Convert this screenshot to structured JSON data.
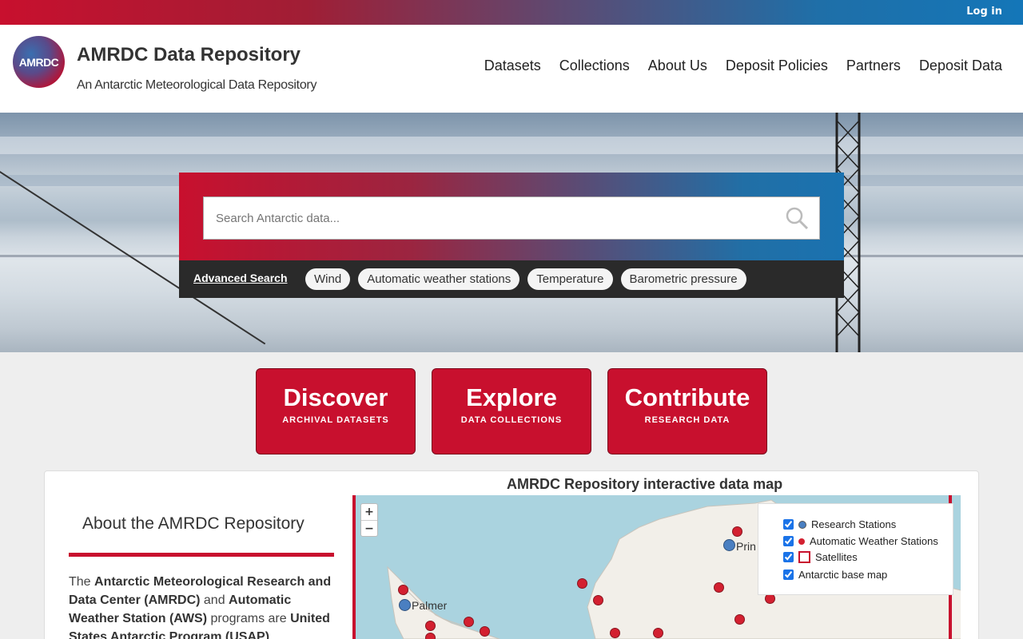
{
  "topbar": {
    "login": "Log in"
  },
  "header": {
    "logo_text": "AMRDC",
    "title": "AMRDC Data Repository",
    "subtitle": "An Antarctic Meteorological Data Repository",
    "nav": [
      "Datasets",
      "Collections",
      "About Us",
      "Deposit Policies",
      "Partners",
      "Deposit Data"
    ]
  },
  "search": {
    "placeholder": "Search Antarctic data...",
    "advanced": "Advanced Search",
    "tags": [
      "Wind",
      "Automatic weather stations",
      "Temperature",
      "Barometric pressure"
    ]
  },
  "cta": [
    {
      "title": "Discover",
      "sub": "ARCHIVAL DATASETS"
    },
    {
      "title": "Explore",
      "sub": "DATA COLLECTIONS"
    },
    {
      "title": "Contribute",
      "sub": "RESEARCH DATA"
    }
  ],
  "about": {
    "title": "About the AMRDC Repository",
    "t1": "The ",
    "b1": "Antarctic Meteorological Research and Data Center (AMRDC)",
    "t2": " and ",
    "b2": "Automatic Weather Station (AWS)",
    "t3": " programs are ",
    "b3": "United States Antarctic Program (USAP)"
  },
  "map": {
    "title": "AMRDC Repository interactive data map",
    "zoom_in": "+",
    "zoom_out": "−",
    "legend": [
      "Research Stations",
      "Automatic Weather Stations",
      "Satellites",
      "Antarctic base map"
    ],
    "labels": [
      "Palmer",
      "Prin"
    ]
  },
  "colors": {
    "brand_red": "#c8102e",
    "brand_blue": "#1476b8"
  }
}
